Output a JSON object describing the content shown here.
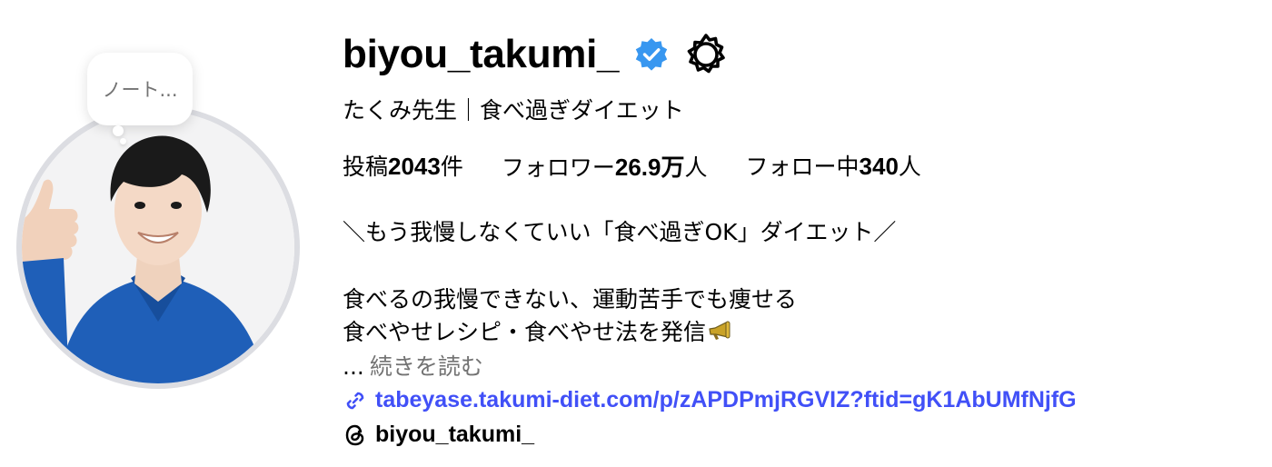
{
  "profile": {
    "username": "biyou_takumi_",
    "full_name": "たくみ先生｜食べ過ぎダイエット",
    "note": "ノート...",
    "stats": {
      "posts_label": "投稿",
      "posts_value": "2043",
      "posts_unit": "件",
      "followers_label": "フォロワー",
      "followers_value": "26.9万",
      "followers_unit": "人",
      "following_label": "フォロー中",
      "following_value": "340",
      "following_unit": "人"
    },
    "bio": {
      "line1": "＼もう我慢しなくていい「食べ過ぎOK」ダイエット／",
      "line2": "食べるの我慢できない、運動苦手でも痩せる",
      "line3": "食べやせレシピ・食べやせ法を発信"
    },
    "more": {
      "ellipsis": "...",
      "label": "続きを読む"
    },
    "link": "tabeyase.takumi-diet.com/p/zAPDPmjRGVIZ?ftid=gK1AbUMfNjfG",
    "threads_handle": "biyou_takumi_"
  },
  "icons": {
    "verified": "verified-badge-icon",
    "settings": "gear-icon",
    "link": "link-icon",
    "threads": "threads-icon",
    "megaphone": "megaphone-icon"
  },
  "colors": {
    "link": "#4150f7",
    "verified": "#3897f0",
    "muted": "#737373",
    "avatar_ring": "#dcdde2"
  }
}
